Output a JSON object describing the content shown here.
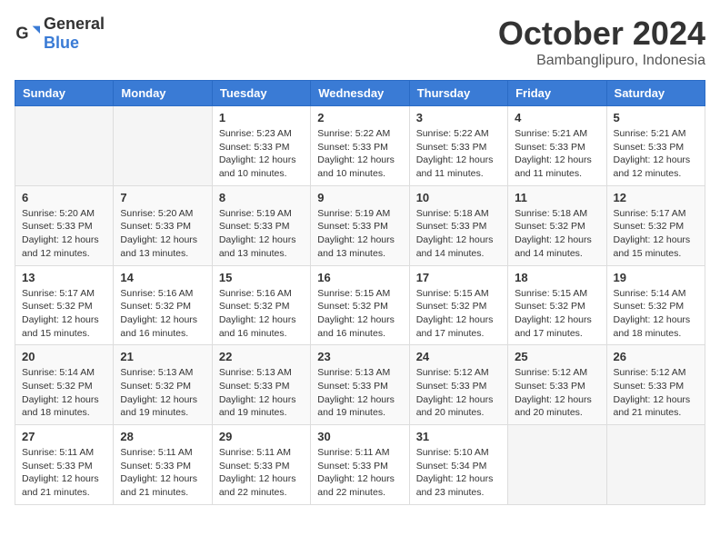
{
  "header": {
    "logo_general": "General",
    "logo_blue": "Blue",
    "month_title": "October 2024",
    "location": "Bambanglipuro, Indonesia"
  },
  "days_of_week": [
    "Sunday",
    "Monday",
    "Tuesday",
    "Wednesday",
    "Thursday",
    "Friday",
    "Saturday"
  ],
  "weeks": [
    [
      {
        "day": "",
        "info": ""
      },
      {
        "day": "",
        "info": ""
      },
      {
        "day": "1",
        "info": "Sunrise: 5:23 AM\nSunset: 5:33 PM\nDaylight: 12 hours\nand 10 minutes."
      },
      {
        "day": "2",
        "info": "Sunrise: 5:22 AM\nSunset: 5:33 PM\nDaylight: 12 hours\nand 10 minutes."
      },
      {
        "day": "3",
        "info": "Sunrise: 5:22 AM\nSunset: 5:33 PM\nDaylight: 12 hours\nand 11 minutes."
      },
      {
        "day": "4",
        "info": "Sunrise: 5:21 AM\nSunset: 5:33 PM\nDaylight: 12 hours\nand 11 minutes."
      },
      {
        "day": "5",
        "info": "Sunrise: 5:21 AM\nSunset: 5:33 PM\nDaylight: 12 hours\nand 12 minutes."
      }
    ],
    [
      {
        "day": "6",
        "info": "Sunrise: 5:20 AM\nSunset: 5:33 PM\nDaylight: 12 hours\nand 12 minutes."
      },
      {
        "day": "7",
        "info": "Sunrise: 5:20 AM\nSunset: 5:33 PM\nDaylight: 12 hours\nand 13 minutes."
      },
      {
        "day": "8",
        "info": "Sunrise: 5:19 AM\nSunset: 5:33 PM\nDaylight: 12 hours\nand 13 minutes."
      },
      {
        "day": "9",
        "info": "Sunrise: 5:19 AM\nSunset: 5:33 PM\nDaylight: 12 hours\nand 13 minutes."
      },
      {
        "day": "10",
        "info": "Sunrise: 5:18 AM\nSunset: 5:33 PM\nDaylight: 12 hours\nand 14 minutes."
      },
      {
        "day": "11",
        "info": "Sunrise: 5:18 AM\nSunset: 5:32 PM\nDaylight: 12 hours\nand 14 minutes."
      },
      {
        "day": "12",
        "info": "Sunrise: 5:17 AM\nSunset: 5:32 PM\nDaylight: 12 hours\nand 15 minutes."
      }
    ],
    [
      {
        "day": "13",
        "info": "Sunrise: 5:17 AM\nSunset: 5:32 PM\nDaylight: 12 hours\nand 15 minutes."
      },
      {
        "day": "14",
        "info": "Sunrise: 5:16 AM\nSunset: 5:32 PM\nDaylight: 12 hours\nand 16 minutes."
      },
      {
        "day": "15",
        "info": "Sunrise: 5:16 AM\nSunset: 5:32 PM\nDaylight: 12 hours\nand 16 minutes."
      },
      {
        "day": "16",
        "info": "Sunrise: 5:15 AM\nSunset: 5:32 PM\nDaylight: 12 hours\nand 16 minutes."
      },
      {
        "day": "17",
        "info": "Sunrise: 5:15 AM\nSunset: 5:32 PM\nDaylight: 12 hours\nand 17 minutes."
      },
      {
        "day": "18",
        "info": "Sunrise: 5:15 AM\nSunset: 5:32 PM\nDaylight: 12 hours\nand 17 minutes."
      },
      {
        "day": "19",
        "info": "Sunrise: 5:14 AM\nSunset: 5:32 PM\nDaylight: 12 hours\nand 18 minutes."
      }
    ],
    [
      {
        "day": "20",
        "info": "Sunrise: 5:14 AM\nSunset: 5:32 PM\nDaylight: 12 hours\nand 18 minutes."
      },
      {
        "day": "21",
        "info": "Sunrise: 5:13 AM\nSunset: 5:32 PM\nDaylight: 12 hours\nand 19 minutes."
      },
      {
        "day": "22",
        "info": "Sunrise: 5:13 AM\nSunset: 5:33 PM\nDaylight: 12 hours\nand 19 minutes."
      },
      {
        "day": "23",
        "info": "Sunrise: 5:13 AM\nSunset: 5:33 PM\nDaylight: 12 hours\nand 19 minutes."
      },
      {
        "day": "24",
        "info": "Sunrise: 5:12 AM\nSunset: 5:33 PM\nDaylight: 12 hours\nand 20 minutes."
      },
      {
        "day": "25",
        "info": "Sunrise: 5:12 AM\nSunset: 5:33 PM\nDaylight: 12 hours\nand 20 minutes."
      },
      {
        "day": "26",
        "info": "Sunrise: 5:12 AM\nSunset: 5:33 PM\nDaylight: 12 hours\nand 21 minutes."
      }
    ],
    [
      {
        "day": "27",
        "info": "Sunrise: 5:11 AM\nSunset: 5:33 PM\nDaylight: 12 hours\nand 21 minutes."
      },
      {
        "day": "28",
        "info": "Sunrise: 5:11 AM\nSunset: 5:33 PM\nDaylight: 12 hours\nand 21 minutes."
      },
      {
        "day": "29",
        "info": "Sunrise: 5:11 AM\nSunset: 5:33 PM\nDaylight: 12 hours\nand 22 minutes."
      },
      {
        "day": "30",
        "info": "Sunrise: 5:11 AM\nSunset: 5:33 PM\nDaylight: 12 hours\nand 22 minutes."
      },
      {
        "day": "31",
        "info": "Sunrise: 5:10 AM\nSunset: 5:34 PM\nDaylight: 12 hours\nand 23 minutes."
      },
      {
        "day": "",
        "info": ""
      },
      {
        "day": "",
        "info": ""
      }
    ]
  ]
}
